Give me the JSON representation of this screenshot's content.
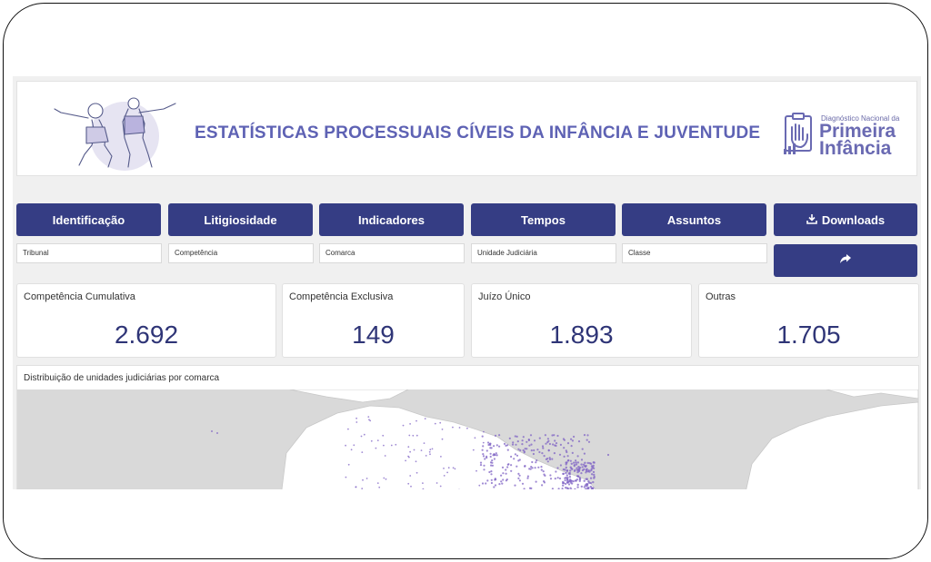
{
  "header": {
    "title": "ESTATÍSTICAS PROCESSUAIS CÍVEIS DA INFÂNCIA E JUVENTUDE",
    "logo": {
      "subtitle": "Diagnóstico Nacional da",
      "line1": "Primeira",
      "line2": "Infância"
    }
  },
  "nav": {
    "buttons": [
      {
        "label": "Identificação"
      },
      {
        "label": "Litigiosidade"
      },
      {
        "label": "Indicadores"
      },
      {
        "label": "Tempos"
      },
      {
        "label": "Assuntos"
      }
    ],
    "downloads": {
      "label": "Downloads",
      "icon": "download-icon"
    },
    "share": {
      "icon": "share-arrow-icon"
    }
  },
  "filters": [
    {
      "label": "Tribunal"
    },
    {
      "label": "Competência"
    },
    {
      "label": "Comarca"
    },
    {
      "label": "Unidade Judiciária"
    },
    {
      "label": "Classe"
    }
  ],
  "kpis": [
    {
      "label": "Competência Cumulativa",
      "value": "2.692"
    },
    {
      "label": "Competência Exclusiva",
      "value": "149"
    },
    {
      "label": "Juízo Único",
      "value": "1.893"
    },
    {
      "label": "Outras",
      "value": "1.705"
    }
  ],
  "map": {
    "title": "Distribuição de unidades judiciárias por comarca"
  },
  "colors": {
    "primary": "#353d84",
    "title": "#5e62b4",
    "kpi_value": "#2f3577",
    "map_land": "#ffffff",
    "map_sea": "#d9d9d9",
    "map_dot": "#7f63c4"
  }
}
